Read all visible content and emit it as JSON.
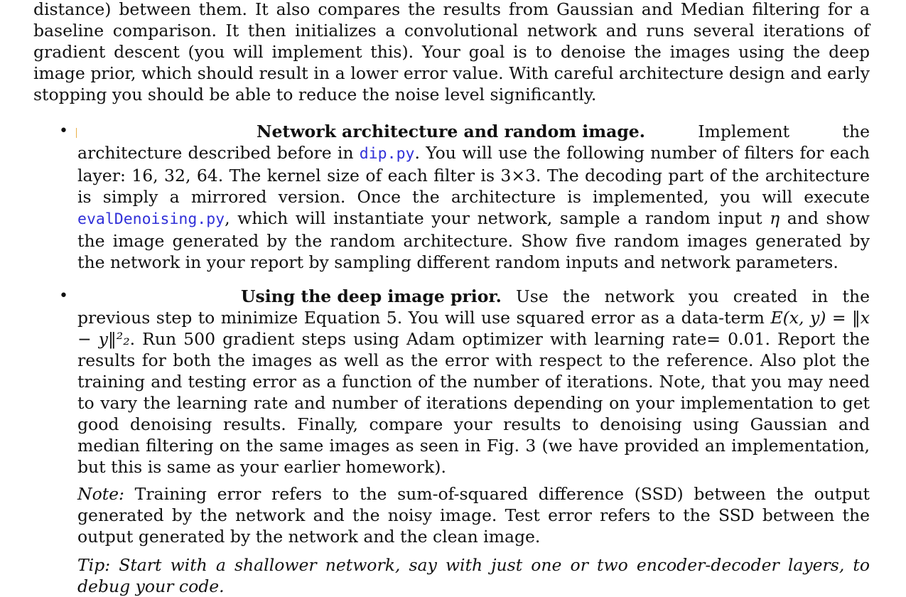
{
  "intro": "distance) between them. It also compares the results from Gaussian and Median filtering for a baseline comparison. It then initializes a convolutional network and runs several iterations of gradient descent (you will implement this). Your goal is to denoise the images using the deep image prior, which should result in a lower error value. With careful architecture design and early stopping you should be able to reduce the noise level significantly.",
  "items": [
    {
      "bullet": "•",
      "heading": "Network architecture and random image.",
      "p1": " Implement the architecture described before in ",
      "code1": "dip.py",
      "p2": ". You will use the following number of filters for each layer: 16, 32, 64. The kernel size of each filter is 3×3. The decoding part of the architecture is simply a mirrored version. Once the architecture is implemented, you will execute ",
      "code2": "evalDenoising.py",
      "p3": ", which will instantiate your network, sample a random input ",
      "math_eta": "η",
      "p4": " and show the image generated by the random architecture. Show five random images generated by the network in your report by sampling different random inputs and network parameters."
    },
    {
      "bullet": "•",
      "heading": "Using the deep image prior.",
      "p1": " Use the network you created in the previous step to minimize Equation 5. You will use squared error as a data-term ",
      "math_E": "E(x, y) = ‖x − y‖²₂",
      "p2": ". Run 500 gradient steps using Adam optimizer with learning rate= 0.01. Report the results for both the images as well as the error with respect to the reference. Also plot the training and testing error as a function of the number of iterations. Note, that you may need to vary the learning rate and number of iterations depending on your implementation to get good denoising results. Finally, compare your results to denoising using Gaussian and median filtering on the same images as seen in Fig. 3 (we have provided an implementation, but this is same as your earlier homework)."
    }
  ],
  "note": {
    "label": "Note:",
    "text": " Training error refers to the sum-of-squared difference (SSD) between the output generated by the network and the noisy image. Test error refers to the SSD between the output generated by the network and the clean image."
  },
  "tip": "Tip: Start with a shallower network, say with just one or two encoder-decoder layers, to debug your code.",
  "colors": {
    "code": "#3030d8",
    "marker": "#e9b048"
  }
}
